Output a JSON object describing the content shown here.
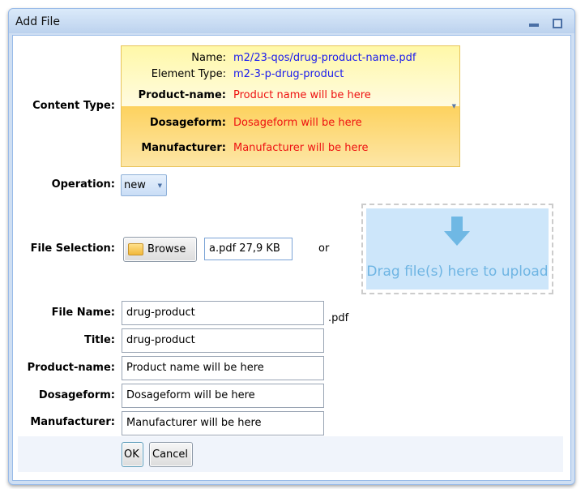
{
  "window": {
    "title": "Add File"
  },
  "content_type": {
    "label": "Content Type:",
    "rows": [
      {
        "label": "Name:",
        "value": "m2/23-qos/drug-product-name.pdf"
      },
      {
        "label": "Element Type:",
        "value": "m2-3-p-drug-product"
      },
      {
        "label": "Product-name:",
        "value": "Product name will be here"
      },
      {
        "label": "Dosageform:",
        "value": "Dosageform will be here"
      },
      {
        "label": "Manufacturer:",
        "value": "Manufacturer will be here"
      }
    ]
  },
  "operation": {
    "label": "Operation:",
    "value": "new"
  },
  "file_selection": {
    "label": "File Selection:",
    "browse": "Browse",
    "file": "a.pdf 27,9 KB",
    "or": "or",
    "drop_text": "Drag file(s) here to upload"
  },
  "fields": [
    {
      "label": "File Name:",
      "value": "drug-product",
      "suffix": ".pdf"
    },
    {
      "label": "Title:",
      "value": "drug-product"
    },
    {
      "label": "Product-name:",
      "value": "Product name will be here"
    },
    {
      "label": "Dosageform:",
      "value": "Dosageform will be here"
    },
    {
      "label": "Manufacturer:",
      "value": "Manufacturer will be here"
    }
  ],
  "buttons": {
    "ok": "OK",
    "cancel": "Cancel"
  },
  "colors": {
    "link_blue": "#1a1aee",
    "placeholder_red": "#ee1111",
    "drop_bg": "#cde6fa"
  }
}
